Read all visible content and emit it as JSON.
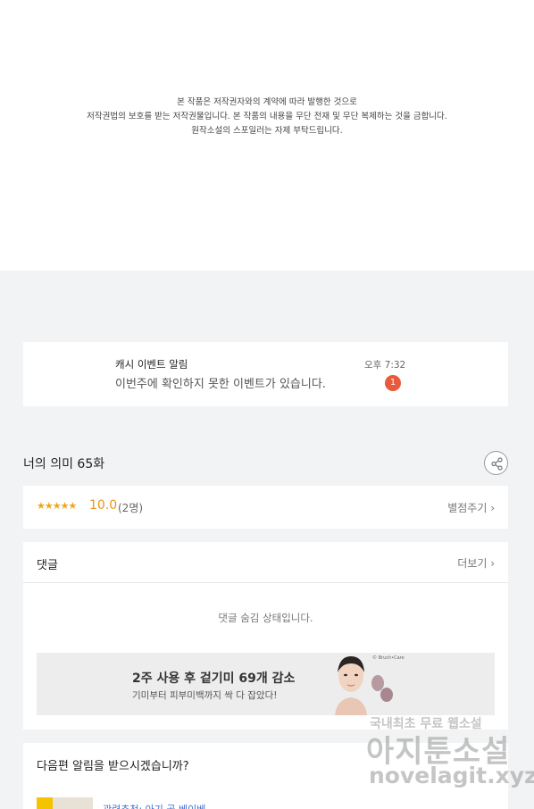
{
  "notice": {
    "line1": "본 작품은 저작권자와의 계약에 따라 발행한 것으로",
    "line2": "저작권법의 보호를 받는 저작권물입니다. 본 작품의 내용을 무단 전재 및 무단 복제하는 것을 금합니다.",
    "line3": "원작소설의 스포일러는 자제 부탁드립니다."
  },
  "event": {
    "title": "캐시 이벤트 알림",
    "message": "이번주에 확인하지 못한 이벤트가 있습니다.",
    "time": "오후 7:32",
    "badge": "1"
  },
  "episode": {
    "title": "너의 의미 65화",
    "share_icon": "share-icon"
  },
  "rating": {
    "stars": "★★★★★",
    "score": "10.0",
    "count": "(2명)",
    "rate_label": "별점주기 ›"
  },
  "comments": {
    "title": "댓글",
    "more_label": "더보기 ›",
    "hidden_message": "댓글 숨김 상태입니다."
  },
  "ad": {
    "headline": "2주 사용 후 겉기미 69개 감소",
    "subline": "기미부터 피부미백까지 싹 다 잡았다!",
    "brand": "© Bruch•Care"
  },
  "next": {
    "title": "다음편 알림을 받으시겠습니까?",
    "link": "관련추천: 아기 곰 베이베"
  },
  "watermark": {
    "top": "국내최초 무료 웹소설",
    "main": "아지툰소설",
    "url": "novelagit.xyz"
  },
  "colors": {
    "background": "#f2f3f4",
    "badge": "#e85a3b",
    "star": "#f2a51a",
    "link": "#3a6fd8"
  }
}
